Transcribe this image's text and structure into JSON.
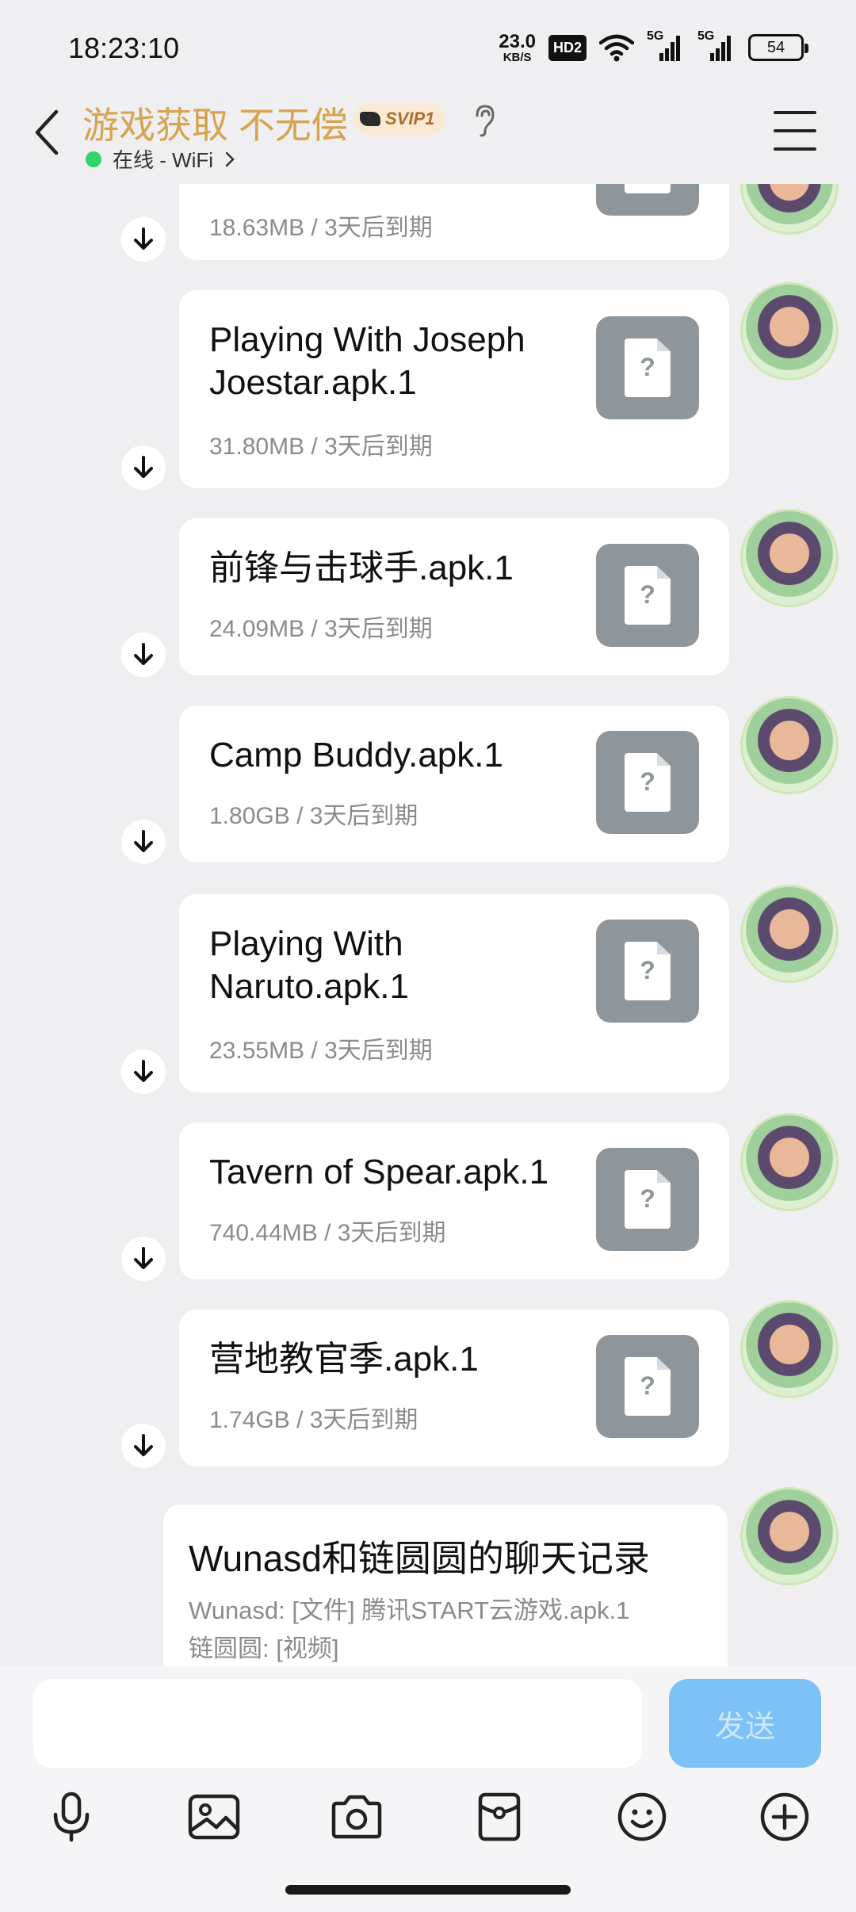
{
  "status_bar": {
    "time": "18:23:10",
    "net_speed_value": "23.0",
    "net_speed_unit": "KB/S",
    "hd_label": "HD2",
    "signal1_label": "5G",
    "signal2_label": "5G",
    "battery": "54"
  },
  "header": {
    "title": "游戏获取 不无偿",
    "badge": "SVIP1",
    "status": "在线 - WiFi",
    "icons": [
      "back-icon",
      "ear-icon",
      "menu-icon"
    ]
  },
  "messages": [
    {
      "name": "",
      "meta": "18.63MB / 3天后到期"
    },
    {
      "name": "Playing With Joseph Joestar.apk.1",
      "meta": "31.80MB / 3天后到期"
    },
    {
      "name": "前锋与击球手.apk.1",
      "meta": "24.09MB / 3天后到期"
    },
    {
      "name": "Camp Buddy.apk.1",
      "meta": "1.80GB / 3天后到期"
    },
    {
      "name": "Playing With Naruto.apk.1",
      "meta": "23.55MB / 3天后到期"
    },
    {
      "name": "Tavern of Spear.apk.1",
      "meta": "740.44MB / 3天后到期"
    },
    {
      "name": "营地教官季.apk.1",
      "meta": "1.74GB / 3天后到期"
    }
  ],
  "chat_history": {
    "title": "Wunasd和链圆圆的聊天记录",
    "line1": "Wunasd: [文件] 腾讯START云游戏.apk.1",
    "line2": "链圆圆: [视频]"
  },
  "input": {
    "value": "",
    "send_label": "发送",
    "send_color": "#7cc2f7"
  },
  "toolbar": [
    "microphone-icon",
    "image-icon",
    "camera-icon",
    "red-packet-icon",
    "emoji-icon",
    "add-icon"
  ],
  "colors": {
    "title": "#d6a34e",
    "online": "#32d36b",
    "background": "#efeff1"
  }
}
